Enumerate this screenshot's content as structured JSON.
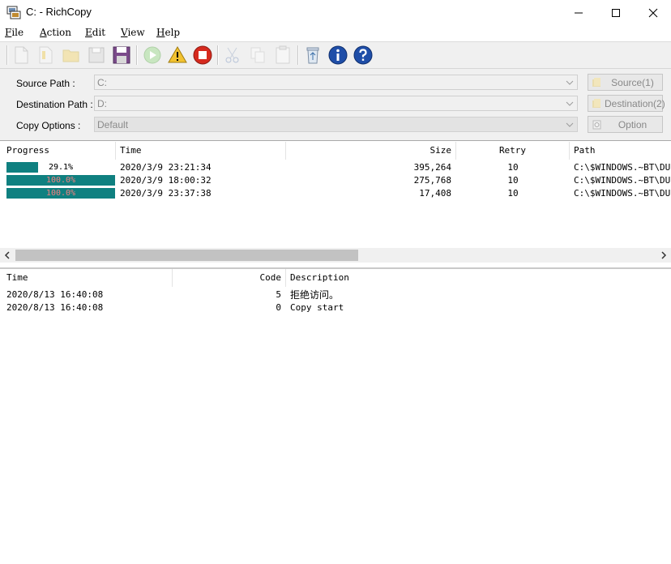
{
  "window": {
    "title": "C: - RichCopy"
  },
  "menu": [
    "File",
    "Action",
    "Edit",
    "View",
    "Help"
  ],
  "toolbar": {
    "buttons": [
      "new-icon",
      "open-icon",
      "folder-icon",
      "save-icon",
      "save-as-icon",
      "start-icon",
      "warning-icon",
      "stop-icon",
      "cut-icon",
      "copy-icon",
      "paste-icon",
      "recycle-icon",
      "info-icon",
      "help-icon"
    ]
  },
  "form": {
    "source_label": "Source Path :",
    "source_value": "C:",
    "destination_label": "Destination Path :",
    "destination_value": "D:",
    "options_label": "Copy Options :",
    "options_value": "Default",
    "source_button": "Source(1)",
    "destination_button": "Destination(2)",
    "option_button": "Option"
  },
  "file_list": {
    "columns": [
      "Progress",
      "Time",
      "Size",
      "Retry",
      "Path"
    ],
    "rows": [
      {
        "progress": 0.291,
        "progress_label": "29.1%",
        "time": "2020/3/9 23:21:34",
        "size": "395,264",
        "retry": "10",
        "path": "C:\\$WINDOWS.~BT\\DUDown"
      },
      {
        "progress": 1.0,
        "progress_label": "100.0%",
        "time": "2020/3/9 18:00:32",
        "size": "275,768",
        "retry": "10",
        "path": "C:\\$WINDOWS.~BT\\DUDown"
      },
      {
        "progress": 1.0,
        "progress_label": "100.0%",
        "time": "2020/3/9 23:37:38",
        "size": "17,408",
        "retry": "10",
        "path": "C:\\$WINDOWS.~BT\\DUDown"
      }
    ]
  },
  "log": {
    "columns": [
      "Time",
      "Code",
      "Description"
    ],
    "rows": [
      {
        "time": "2020/8/13 16:40:08",
        "code": "5",
        "description": "拒绝访问。"
      },
      {
        "time": "2020/8/13 16:40:08",
        "code": "0",
        "description": "Copy start"
      }
    ]
  },
  "colors": {
    "progress_fill": "#0f8080"
  }
}
